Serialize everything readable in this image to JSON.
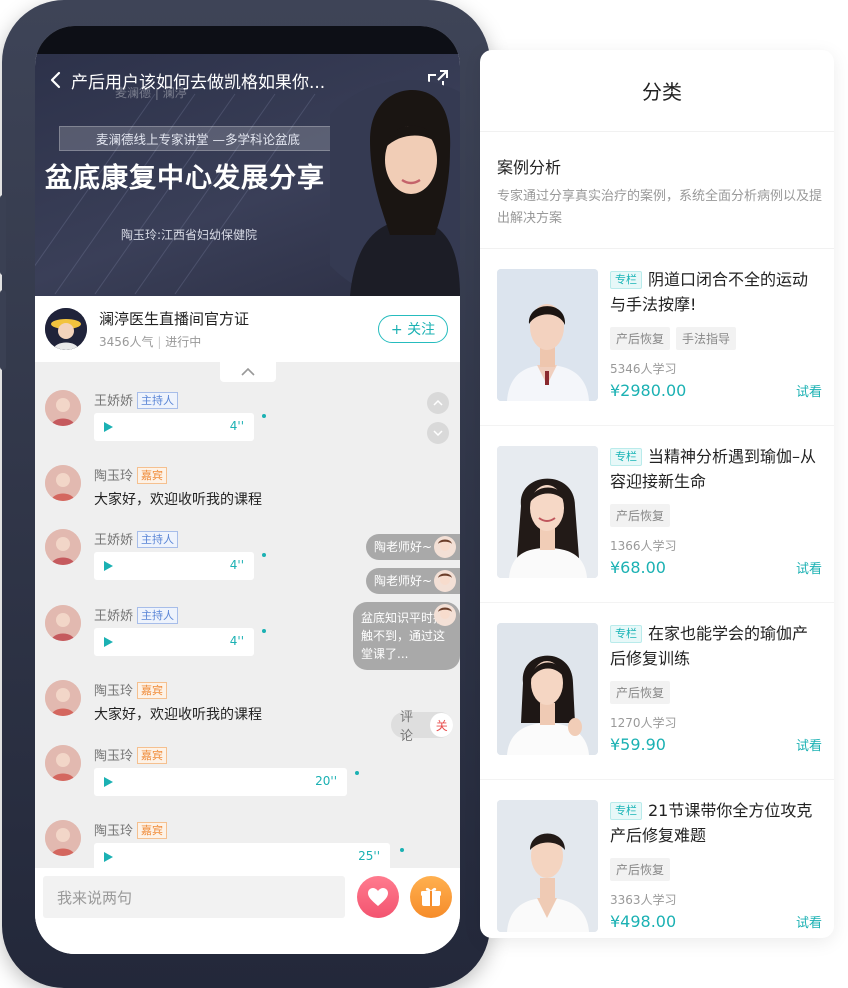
{
  "banner": {
    "title": "产后用户该如何去做凯格如果你...",
    "brand": "麦澜德 | 澜渟",
    "lecture": "麦澜德线上专家讲堂 —多学科论盆底",
    "main_title": "盆底康复中心发展分享",
    "speaker": "陶玉玲:江西省妇幼保健院"
  },
  "host": {
    "name": "澜渟医生直播间官方证",
    "popularity": "3456人气",
    "status": "进行中",
    "follow_label": "+ 关注"
  },
  "messages": [
    {
      "name": "王娇娇",
      "role": "主持人",
      "type": "voice",
      "duration": "4''"
    },
    {
      "name": "陶玉玲",
      "role": "嘉宾",
      "type": "text",
      "text": "大家好，欢迎收听我的课程"
    },
    {
      "name": "王娇娇",
      "role": "主持人",
      "type": "voice",
      "duration": "4''"
    },
    {
      "name": "王娇娇",
      "role": "主持人",
      "type": "voice",
      "duration": "4''"
    },
    {
      "name": "陶玉玲",
      "role": "嘉宾",
      "type": "text",
      "text": "大家好，欢迎收听我的课程"
    },
    {
      "name": "陶玉玲",
      "role": "嘉宾",
      "type": "voice",
      "duration": "20''"
    },
    {
      "name": "陶玉玲",
      "role": "嘉宾",
      "type": "voice",
      "duration": "25''"
    }
  ],
  "side_comments": [
    "陶老师好~",
    "陶老师好~",
    "盆底知识平时接触不到，通过这堂课了..."
  ],
  "comment_toggle": {
    "label": "评论",
    "close": "关"
  },
  "input": {
    "placeholder": "我来说两句"
  },
  "category": {
    "title": "分类",
    "intro_title": "案例分析",
    "intro_desc": "专家通过分享真实治疗的案例，系统全面分析病例以及提出解决方案"
  },
  "courses": [
    {
      "badge": "专栏",
      "title": "阴道口闭合不全的运动与手法按摩!",
      "tags": [
        "产后恢复",
        "手法指导"
      ],
      "learners": "5346人学习",
      "price": "¥2980.00",
      "trial": "试看"
    },
    {
      "badge": "专栏",
      "title": "当精神分析遇到瑜伽–从容迎接新生命",
      "tags": [
        "产后恢复"
      ],
      "learners": "1366人学习",
      "price": "¥68.00",
      "trial": "试看"
    },
    {
      "badge": "专栏",
      "title": "在家也能学会的瑜伽产后修复训练",
      "tags": [
        "产后恢复"
      ],
      "learners": "1270人学习",
      "price": "¥59.90",
      "trial": "试看"
    },
    {
      "badge": "专栏",
      "title": "21节课带你全方位攻克产后修复难题",
      "tags": [
        "产后恢复"
      ],
      "learners": "3363人学习",
      "price": "¥498.00",
      "trial": "试看"
    }
  ],
  "colors": {
    "accent": "#1bb1b3",
    "host_role": "#5b86d6",
    "guest_role": "#f08c3a",
    "phone_frame": "#2b3042"
  }
}
